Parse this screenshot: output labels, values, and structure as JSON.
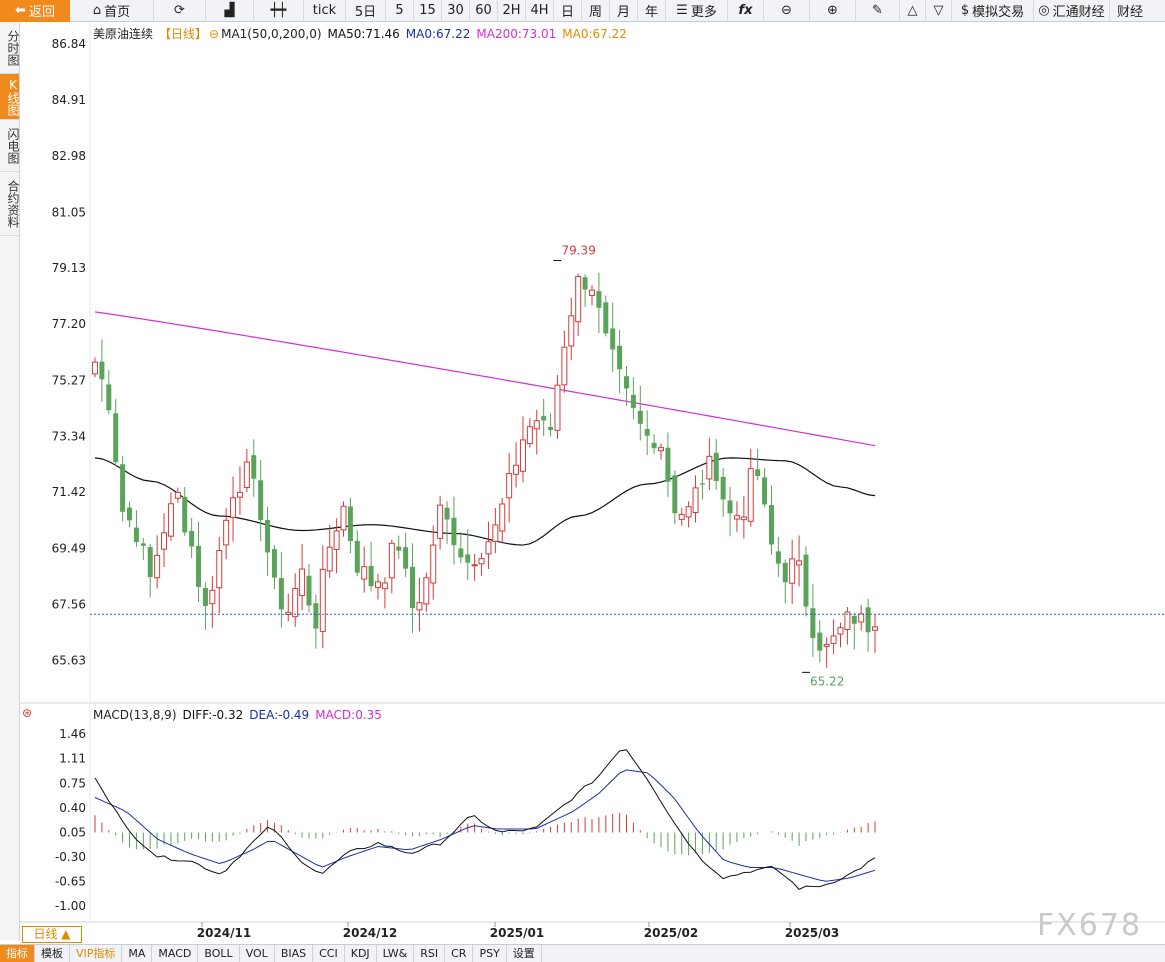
{
  "toolbar": {
    "back": "返回",
    "home": "首页",
    "tick": "tick",
    "periods": [
      "5日",
      "5",
      "15",
      "30",
      "60",
      "2H",
      "4H",
      "日",
      "周",
      "月",
      "年"
    ],
    "more": "更多",
    "fx": "fx",
    "sim_trade": "模拟交易",
    "news1": "汇通财经",
    "news2": "财经"
  },
  "sidebar": {
    "items": [
      {
        "label": "分时图"
      },
      {
        "label": "K线图"
      },
      {
        "label": "闪电图"
      },
      {
        "label": "合约资料"
      }
    ]
  },
  "legend": {
    "name": "美原油连续",
    "period": "【日线】",
    "ma1": "MA1(50,0,200,0)",
    "ma50": "MA50:71.46",
    "ma0a": "MA0:67.22",
    "ma200": "MA200:73.01",
    "ma0b": "MA0:67.22"
  },
  "macd_legend": {
    "name": "MACD(13,8,9)",
    "diff": "DIFF:-0.32",
    "dea": "DEA:-0.49",
    "macd": "MACD:0.35"
  },
  "colors": {
    "up": "#d23b3b",
    "down": "#5aa35a",
    "ma50": "#111111",
    "ma200": "#d22fd2",
    "dea": "#1b2fa8",
    "accent": "#f08a1c"
  },
  "chart_data": [
    {
      "type": "candlestick",
      "title": "美原油连续",
      "y_ticks": [
        "86.84",
        "84.91",
        "82.98",
        "81.05",
        "79.13",
        "77.20",
        "75.27",
        "73.34",
        "71.42",
        "69.49",
        "67.56",
        "65.63"
      ],
      "ylim": [
        64.2,
        86.84
      ],
      "x_ticks": [
        "2024/11",
        "2024/12",
        "2025/01",
        "2025/02",
        "2025/03"
      ],
      "high_marker": "79.39",
      "low_marker": "65.22",
      "current_price": 67.22,
      "series_names": [
        "MA50",
        "MA200"
      ]
    },
    {
      "type": "macd",
      "y_ticks": [
        "1.46",
        "1.11",
        "0.75",
        "0.40",
        "0.05",
        "-0.30",
        "-0.65",
        "-1.00"
      ],
      "ylim": [
        -1.2,
        1.6
      ],
      "diff": -0.32,
      "dea": -0.49,
      "macd": 0.35
    }
  ],
  "bottom": {
    "period_tab": "日线 ▲",
    "tabs": [
      "指标",
      "模板",
      "VIP指标",
      "MA",
      "MACD",
      "BOLL",
      "VOL",
      "BIAS",
      "CCI",
      "KDJ",
      "LW&",
      "RSI",
      "CR",
      "PSY",
      "设置"
    ]
  },
  "watermark": "FX678"
}
